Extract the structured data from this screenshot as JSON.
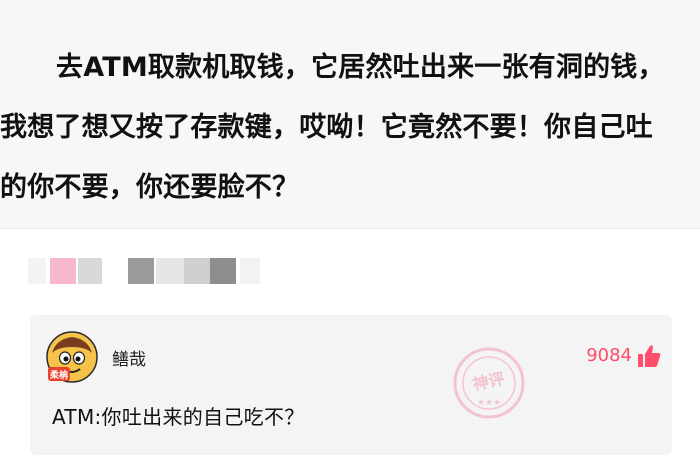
{
  "post": {
    "text": "去ATM取款机取钱，它居然吐出来一张有洞的钱，我想了想又按了存款键，哎呦！它竟然不要！你自己吐的你不要，你还要脸不？"
  },
  "comment": {
    "username": "鳝哉",
    "text": "ATM:你吐出来的自己吃不？",
    "likes": "9084",
    "avatar_icon": "cartoon-face-icon",
    "like_icon": "thumbs-up-icon",
    "badge_icon": "god-comment-stamp-icon",
    "badge_text": "神评",
    "avatar_badge_text": "柔柟",
    "accent_color": "#ff4d6a"
  }
}
